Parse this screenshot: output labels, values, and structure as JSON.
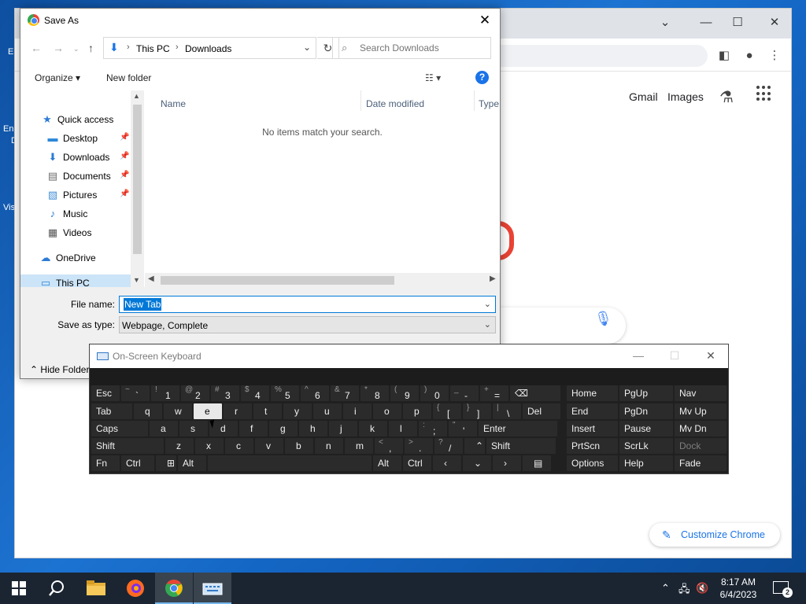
{
  "desktop": {
    "icon_labels": [
      "E",
      "En",
      "D",
      "Vis"
    ]
  },
  "chrome": {
    "header_links": {
      "gmail": "Gmail",
      "images": "Images"
    },
    "customize_label": "Customize Chrome",
    "window_controls": {
      "minimize": "—",
      "maximize": "☐",
      "close": "✕",
      "tabs": "⌄"
    }
  },
  "save_dialog": {
    "title": "Save As",
    "close": "✕",
    "address": {
      "crumbs": [
        "This PC",
        "Downloads"
      ],
      "separator": "›"
    },
    "search_placeholder": "Search Downloads",
    "commands": {
      "organize": "Organize ▾",
      "new_folder": "New folder",
      "help": "?"
    },
    "nav_items": [
      {
        "label": "Quick access",
        "icon": "star-icon",
        "glyph": "★",
        "color": "#2d7bd4"
      },
      {
        "label": "Desktop",
        "icon": "desktop-icon",
        "glyph": "▬",
        "color": "#2e88d8",
        "pinned": true
      },
      {
        "label": "Downloads",
        "icon": "download-icon",
        "glyph": "⬇",
        "color": "#2d7bd4",
        "pinned": true
      },
      {
        "label": "Documents",
        "icon": "documents-icon",
        "glyph": "▤",
        "color": "#6b6b6b",
        "pinned": true
      },
      {
        "label": "Pictures",
        "icon": "pictures-icon",
        "glyph": "▧",
        "color": "#3f8fd6",
        "pinned": true
      },
      {
        "label": "Music",
        "icon": "music-icon",
        "glyph": "♪",
        "color": "#2d7bd4"
      },
      {
        "label": "Videos",
        "icon": "videos-icon",
        "glyph": "▦",
        "color": "#555555"
      },
      {
        "label": "OneDrive",
        "icon": "cloud-icon",
        "glyph": "☁",
        "color": "#2d7bd4"
      },
      {
        "label": "This PC",
        "icon": "computer-icon",
        "glyph": "▭",
        "color": "#2e88d8",
        "selected": true
      }
    ],
    "columns": [
      "Name",
      "Date modified",
      "Type"
    ],
    "empty_message": "No items match your search.",
    "file_name": {
      "label": "File name:",
      "value": "New Tab"
    },
    "save_type": {
      "label": "Save as type:",
      "value": "Webpage, Complete"
    },
    "hide_folders": "Hide Folders"
  },
  "osk": {
    "title": "On-Screen Keyboard",
    "window_controls": {
      "minimize": "—",
      "maximize": "☐",
      "close": "✕"
    },
    "rows": [
      [
        {
          "m": "Esc",
          "w": 36
        },
        {
          "m": "`",
          "s": "~",
          "w": 36
        },
        {
          "m": "1",
          "s": "!",
          "w": 36
        },
        {
          "m": "2",
          "s": "@",
          "w": 36
        },
        {
          "m": "3",
          "s": "#",
          "w": 36
        },
        {
          "m": "4",
          "s": "$",
          "w": 36
        },
        {
          "m": "5",
          "s": "%",
          "w": 36
        },
        {
          "m": "6",
          "s": "^",
          "w": 36
        },
        {
          "m": "7",
          "s": "&",
          "w": 36
        },
        {
          "m": "8",
          "s": "*",
          "w": 36
        },
        {
          "m": "9",
          "s": "(",
          "w": 36
        },
        {
          "m": "0",
          "s": ")",
          "w": 36
        },
        {
          "m": "-",
          "s": "_",
          "w": 36
        },
        {
          "m": "=",
          "s": "+",
          "w": 36
        },
        {
          "m": "⌫",
          "w": 64
        }
      ],
      [
        {
          "m": "Tab",
          "w": 52
        },
        {
          "m": "q",
          "w": 36
        },
        {
          "m": "w",
          "w": 36
        },
        {
          "m": "e",
          "w": 36,
          "pressed": true
        },
        {
          "m": "r",
          "w": 36
        },
        {
          "m": "t",
          "w": 36
        },
        {
          "m": "y",
          "w": 36
        },
        {
          "m": "u",
          "w": 36
        },
        {
          "m": "i",
          "w": 36
        },
        {
          "m": "o",
          "w": 36
        },
        {
          "m": "p",
          "w": 36
        },
        {
          "m": "[",
          "s": "{",
          "w": 36
        },
        {
          "m": "]",
          "s": "}",
          "w": 36
        },
        {
          "m": "\\",
          "s": "|",
          "w": 36
        },
        {
          "m": "Del",
          "w": 48
        }
      ],
      [
        {
          "m": "Caps",
          "w": 72
        },
        {
          "m": "a",
          "w": 36
        },
        {
          "m": "s",
          "w": 36
        },
        {
          "m": "d",
          "w": 36
        },
        {
          "m": "f",
          "w": 36
        },
        {
          "m": "g",
          "w": 36
        },
        {
          "m": "h",
          "w": 36
        },
        {
          "m": "j",
          "w": 36
        },
        {
          "m": "k",
          "w": 36
        },
        {
          "m": "l",
          "w": 36
        },
        {
          "m": ";",
          "s": ":",
          "w": 36
        },
        {
          "m": "'",
          "s": "\"",
          "w": 36
        },
        {
          "m": "Enter",
          "w": 100
        }
      ],
      [
        {
          "m": "Shift",
          "w": 92
        },
        {
          "m": "z",
          "w": 36
        },
        {
          "m": "x",
          "w": 36
        },
        {
          "m": "c",
          "w": 36
        },
        {
          "m": "v",
          "w": 36
        },
        {
          "m": "b",
          "w": 36
        },
        {
          "m": "n",
          "w": 36
        },
        {
          "m": "m",
          "w": 36
        },
        {
          "m": ",",
          "s": "<",
          "w": 36
        },
        {
          "m": ".",
          "s": ">",
          "w": 36
        },
        {
          "m": "/",
          "s": "?",
          "w": 36
        },
        {
          "m": "⌃",
          "w": 26
        },
        {
          "m": "Shift",
          "w": 88
        }
      ],
      [
        {
          "m": "Fn",
          "w": 36
        },
        {
          "m": "Ctrl",
          "w": 42
        },
        {
          "m": "⊞",
          "w": 26
        },
        {
          "m": "Alt",
          "w": 36
        },
        {
          "m": "",
          "w": 208
        },
        {
          "m": "Alt",
          "w": 36
        },
        {
          "m": "Ctrl",
          "w": 36
        },
        {
          "m": "‹",
          "w": 36
        },
        {
          "m": "⌄",
          "w": 36
        },
        {
          "m": "›",
          "w": 36
        },
        {
          "m": "▤",
          "w": 36
        }
      ]
    ],
    "side_keys": [
      [
        "Home",
        "PgUp",
        "Nav"
      ],
      [
        "End",
        "PgDn",
        "Mv Up"
      ],
      [
        "Insert",
        "Pause",
        "Mv Dn"
      ],
      [
        "PrtScn",
        "ScrLk",
        "Dock"
      ],
      [
        "Options",
        "Help",
        "Fade"
      ]
    ]
  },
  "taskbar": {
    "time": "8:17 AM",
    "date": "6/4/2023",
    "notification_count": "2",
    "tray_chevron": "⌃"
  }
}
